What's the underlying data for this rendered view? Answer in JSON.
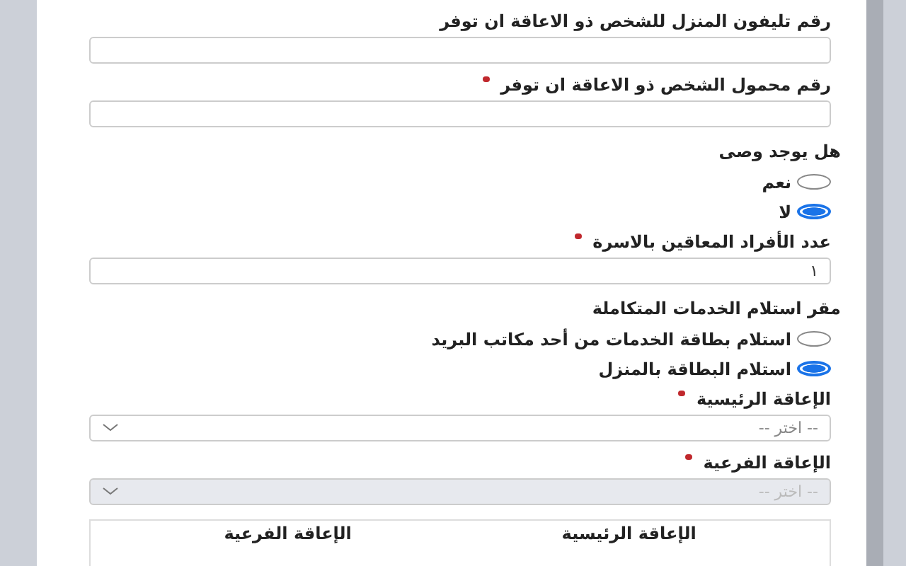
{
  "form": {
    "fields": [
      {
        "kind": "text",
        "label": "رقم تليفون المنزل للشخص ذو الاعاقة ان توفر",
        "required": false
      },
      {
        "kind": "text",
        "label": "رقم محمول الشخص ذو الاعاقة ان توفر",
        "required": true
      },
      {
        "kind": "radio",
        "label": "هل يوجد وصى",
        "required": false,
        "options": [
          {
            "label": "نعم",
            "selected": false
          },
          {
            "label": "لا",
            "selected": true
          }
        ]
      },
      {
        "kind": "text",
        "label": "عدد الأفراد المعاقين بالاسرة",
        "required": true,
        "value": "١"
      },
      {
        "kind": "radio",
        "label": "مقر استلام الخدمات المتكاملة",
        "required": false,
        "options": [
          {
            "label": "استلام بطاقة الخدمات من أحد مكاتب البريد",
            "selected": false
          },
          {
            "label": "استلام البطاقة بالمنزل",
            "selected": true
          }
        ]
      },
      {
        "kind": "select",
        "label": "الإعاقة الرئيسية",
        "required": true,
        "placeholder": "-- اختر --",
        "disabled": false
      },
      {
        "kind": "select",
        "label": "الإعاقة الفرعية",
        "required": true,
        "placeholder": "-- اختر --",
        "disabled": true
      },
      {
        "kind": "table",
        "columns": [
          "الإعاقة الرئيسية",
          "الإعاقة الفرعية"
        ]
      }
    ]
  }
}
